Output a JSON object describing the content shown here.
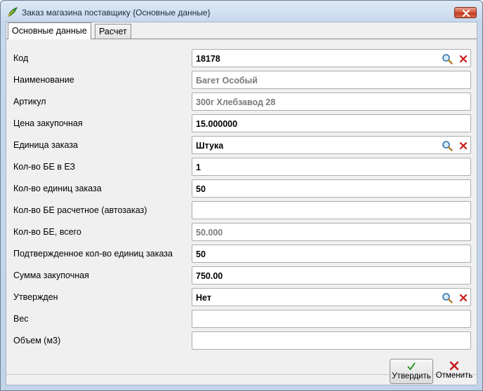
{
  "window": {
    "title": "Заказ магазина поставщику {Основные данные}",
    "accent": "#c2391f"
  },
  "tabs": [
    {
      "label": "Основные данные",
      "active": true
    },
    {
      "label": "Расчет",
      "active": false
    }
  ],
  "fields": [
    {
      "label": "Код",
      "value": "18178",
      "readonly": false,
      "lookup": true
    },
    {
      "label": "Наименование",
      "value": "Багет Особый",
      "readonly": true,
      "lookup": false
    },
    {
      "label": "Артикул",
      "value": "300г Хлебзавод 28",
      "readonly": true,
      "lookup": false
    },
    {
      "label": "Цена закупочная",
      "value": "15.000000",
      "readonly": false,
      "lookup": false
    },
    {
      "label": "Единица заказа",
      "value": "Штука",
      "readonly": false,
      "lookup": true
    },
    {
      "label": "Кол-во БЕ в ЕЗ",
      "value": "1",
      "readonly": false,
      "lookup": false
    },
    {
      "label": "Кол-во единиц заказа",
      "value": "50",
      "readonly": false,
      "lookup": false
    },
    {
      "label": "Кол-во БЕ расчетное (автозаказ)",
      "value": "",
      "readonly": false,
      "lookup": false
    },
    {
      "label": "Кол-во БЕ, всего",
      "value": "50.000",
      "readonly": true,
      "lookup": false
    },
    {
      "label": "Подтвержденное кол-во единиц заказа",
      "value": "50",
      "readonly": false,
      "lookup": false
    },
    {
      "label": "Сумма закупочная",
      "value": "750.00",
      "readonly": false,
      "lookup": false
    },
    {
      "label": "Утвержден",
      "value": "Нет",
      "readonly": false,
      "lookup": true
    },
    {
      "label": "Вес",
      "value": "",
      "readonly": false,
      "lookup": false
    },
    {
      "label": "Объем (м3)",
      "value": "",
      "readonly": false,
      "lookup": false
    }
  ],
  "buttons": {
    "approve_label": "Утвердить",
    "cancel_label": "Отменить"
  },
  "icons": {
    "app": "leaf-icon",
    "lookup": "search-icon",
    "clear": "clear-icon",
    "approve": "checkmark-icon",
    "cancel": "cross-icon"
  }
}
